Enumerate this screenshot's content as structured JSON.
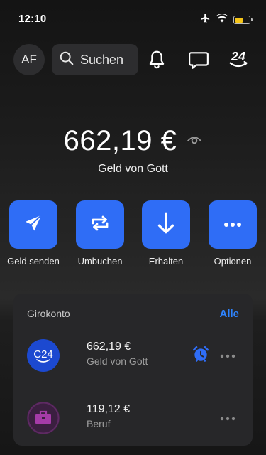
{
  "status_bar": {
    "time": "12:10",
    "icons": [
      "airplane-icon",
      "wifi-icon",
      "battery-icon"
    ]
  },
  "header": {
    "avatar_initials": "AF",
    "search_placeholder": "Suchen",
    "icons": [
      "bell-icon",
      "chat-icon",
      "c24-logo-icon"
    ]
  },
  "balance": {
    "amount": "662,19 €",
    "label": "Geld von Gott",
    "icon": "eye-visibility-icon"
  },
  "actions": [
    {
      "label": "Geld senden",
      "icon": "send-icon"
    },
    {
      "label": "Umbuchen",
      "icon": "transfer-icon"
    },
    {
      "label": "Erhalten",
      "icon": "arrow-down-icon"
    },
    {
      "label": "Optionen",
      "icon": "more-icon"
    }
  ],
  "accounts_card": {
    "title": "Girokonto",
    "link": "Alle",
    "accounts": [
      {
        "amount": "662,19 €",
        "name": "Geld von Gott",
        "icon": "c24-bank-icon",
        "icon_text": "C24",
        "has_alarm": true
      },
      {
        "amount": "119,12 €",
        "name": "Beruf",
        "icon": "briefcase-icon",
        "has_alarm": false
      }
    ]
  },
  "colors": {
    "accent": "#2f6df6",
    "link": "#2e84ff",
    "card_bg": "#272729",
    "battery": "#f5c518"
  }
}
